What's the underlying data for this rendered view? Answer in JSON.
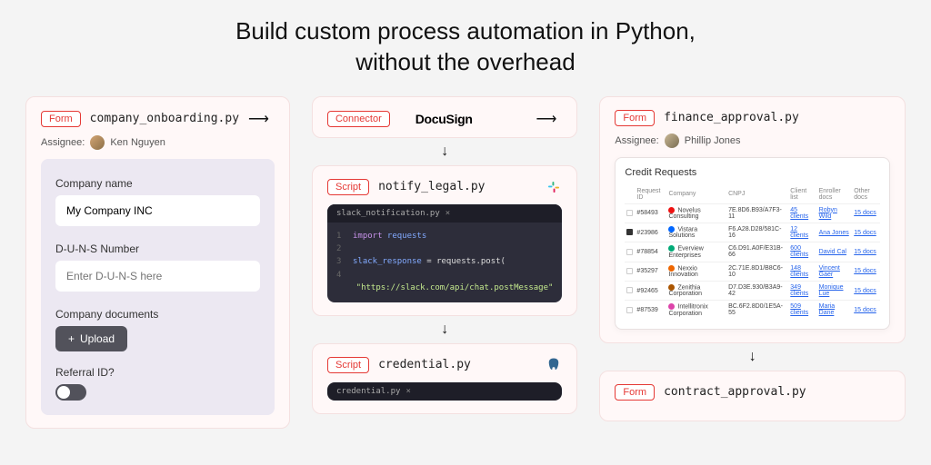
{
  "hero": {
    "line1": "Build custom process automation in Python,",
    "line2": "without the overhead"
  },
  "tags": {
    "form": "Form",
    "connector": "Connector",
    "script": "Script"
  },
  "labels": {
    "assignee": "Assignee:",
    "upload": "Upload"
  },
  "col1": {
    "file": "company_onboarding.py",
    "assignee": "Ken Nguyen",
    "form": {
      "company_label": "Company name",
      "company_value": "My Company INC",
      "duns_label": "D-U-N-S Number",
      "duns_placeholder": "Enter D-U-N-S here",
      "docs_label": "Company documents",
      "referral_label": "Referral ID?"
    }
  },
  "col2": {
    "connector": "DocuSign",
    "script1": {
      "file": "notify_legal.py",
      "tab": "slack_notification.py",
      "code": {
        "l1a": "import",
        "l1b": "requests",
        "l3a": "slack_response",
        "l3b": " = requests.post(",
        "l4": "\"https://slack.com/api/chat.postMessage\""
      }
    },
    "script2": {
      "file": "credential.py",
      "tab": "credential.py"
    }
  },
  "col3": {
    "file": "finance_approval.py",
    "assignee": "Phillip Jones",
    "table": {
      "title": "Credit Requests",
      "headers": [
        "Request ID",
        "Company",
        "CNPJ",
        "Client list",
        "Enroller docs",
        "Other docs"
      ],
      "rows": [
        {
          "id": "#58493",
          "co": "Novelus Consulting",
          "cnpj": "7E.8D6.B93/A7F3-11",
          "cl": "45 clients",
          "en": "Robyn Wild",
          "od": "15 docs",
          "c": "#e11"
        },
        {
          "id": "#23986",
          "co": "Vistara Solutions",
          "cnpj": "F6.A28.D28/581C-16",
          "cl": "12 clients",
          "en": "Ana Jones",
          "od": "15 docs",
          "c": "#06f",
          "chk": true
        },
        {
          "id": "#78854",
          "co": "Everview Enterprises",
          "cnpj": "C6.D91.A0F/E31B-66",
          "cl": "600 clients",
          "en": "David Cal",
          "od": "15 docs",
          "c": "#0a7"
        },
        {
          "id": "#35297",
          "co": "Nexxio Innovation",
          "cnpj": "2C.71E.8D1/B8C6-10",
          "cl": "148 clients",
          "en": "Vincent Gaer",
          "od": "15 docs",
          "c": "#e60"
        },
        {
          "id": "#92465",
          "co": "Zenithia Corporation",
          "cnpj": "D7.D3E.930/B3A9-42",
          "cl": "349 clients",
          "en": "Monique Lue",
          "od": "15 docs",
          "c": "#a50"
        },
        {
          "id": "#87539",
          "co": "Intellitronix Corporation",
          "cnpj": "BC.6F2.8D0/1E5A-55",
          "cl": "509 clients",
          "en": "Maria Dane",
          "od": "15 docs",
          "c": "#d4a"
        }
      ]
    },
    "file2": "contract_approval.py"
  }
}
